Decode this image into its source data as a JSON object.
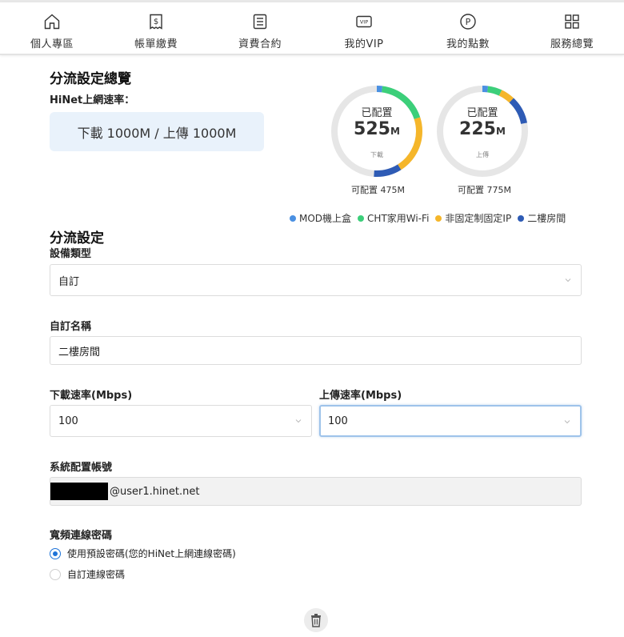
{
  "nav": {
    "items": [
      {
        "label": "個人專區",
        "icon": "home-icon"
      },
      {
        "label": "帳單繳費",
        "icon": "bill-dollar-icon"
      },
      {
        "label": "資費合約",
        "icon": "contract-list-icon"
      },
      {
        "label": "我的VIP",
        "icon": "vip-icon"
      },
      {
        "label": "我的點數",
        "icon": "points-p-icon"
      },
      {
        "label": "服務總覽",
        "icon": "grid-services-icon"
      }
    ]
  },
  "overview": {
    "title": "分流設定總覽",
    "speed_label": "HiNet上網速率：",
    "speed_value": "下載 1000M / 上傳 1000M"
  },
  "donuts": [
    {
      "title": "已配置",
      "value": "525",
      "unit": "M",
      "sub": "下載",
      "caption": "可配置 475M",
      "segments": [
        {
          "color": "#4a90e2",
          "fraction": 0.02
        },
        {
          "color": "#3ccf7a",
          "fraction": 0.18
        },
        {
          "color": "#f5b62a",
          "fraction": 0.21
        },
        {
          "color": "#2e5bb5",
          "fraction": 0.1
        }
      ]
    },
    {
      "title": "已配置",
      "value": "225",
      "unit": "M",
      "sub": "上傳",
      "caption": "可配置 775M",
      "segments": [
        {
          "color": "#4a90e2",
          "fraction": 0.02
        },
        {
          "color": "#3ccf7a",
          "fraction": 0.05
        },
        {
          "color": "#f5b62a",
          "fraction": 0.05
        },
        {
          "color": "#2e5bb5",
          "fraction": 0.1
        }
      ]
    }
  ],
  "legend": [
    {
      "label": "MOD機上盒",
      "color": "#4a90e2"
    },
    {
      "label": "CHT家用Wi-Fi",
      "color": "#3ccf7a"
    },
    {
      "label": "非固定制固定IP",
      "color": "#f5b62a"
    },
    {
      "label": "二樓房間",
      "color": "#2e5bb5"
    }
  ],
  "form": {
    "title": "分流設定",
    "device_type_label": "設備類型",
    "device_type_value": "自訂",
    "custom_name_label": "自訂名稱",
    "custom_name_value": "二樓房間",
    "download_label": "下載速率(Mbps)",
    "download_value": "100",
    "upload_label": "上傳速率(Mbps)",
    "upload_value": "100",
    "account_label": "系統配置帳號",
    "account_value": "@user1.hinet.net",
    "password_label": "寬頻連線密碼",
    "password_option_default": "使用預設密碼(您的HiNet上網連線密碼)",
    "password_option_custom": "自訂連線密碼",
    "password_selected": "default"
  },
  "colors": {
    "track": "#e6e6e6",
    "accent_blue": "#1e73d8",
    "speed_box_bg": "#e9f2fb"
  }
}
